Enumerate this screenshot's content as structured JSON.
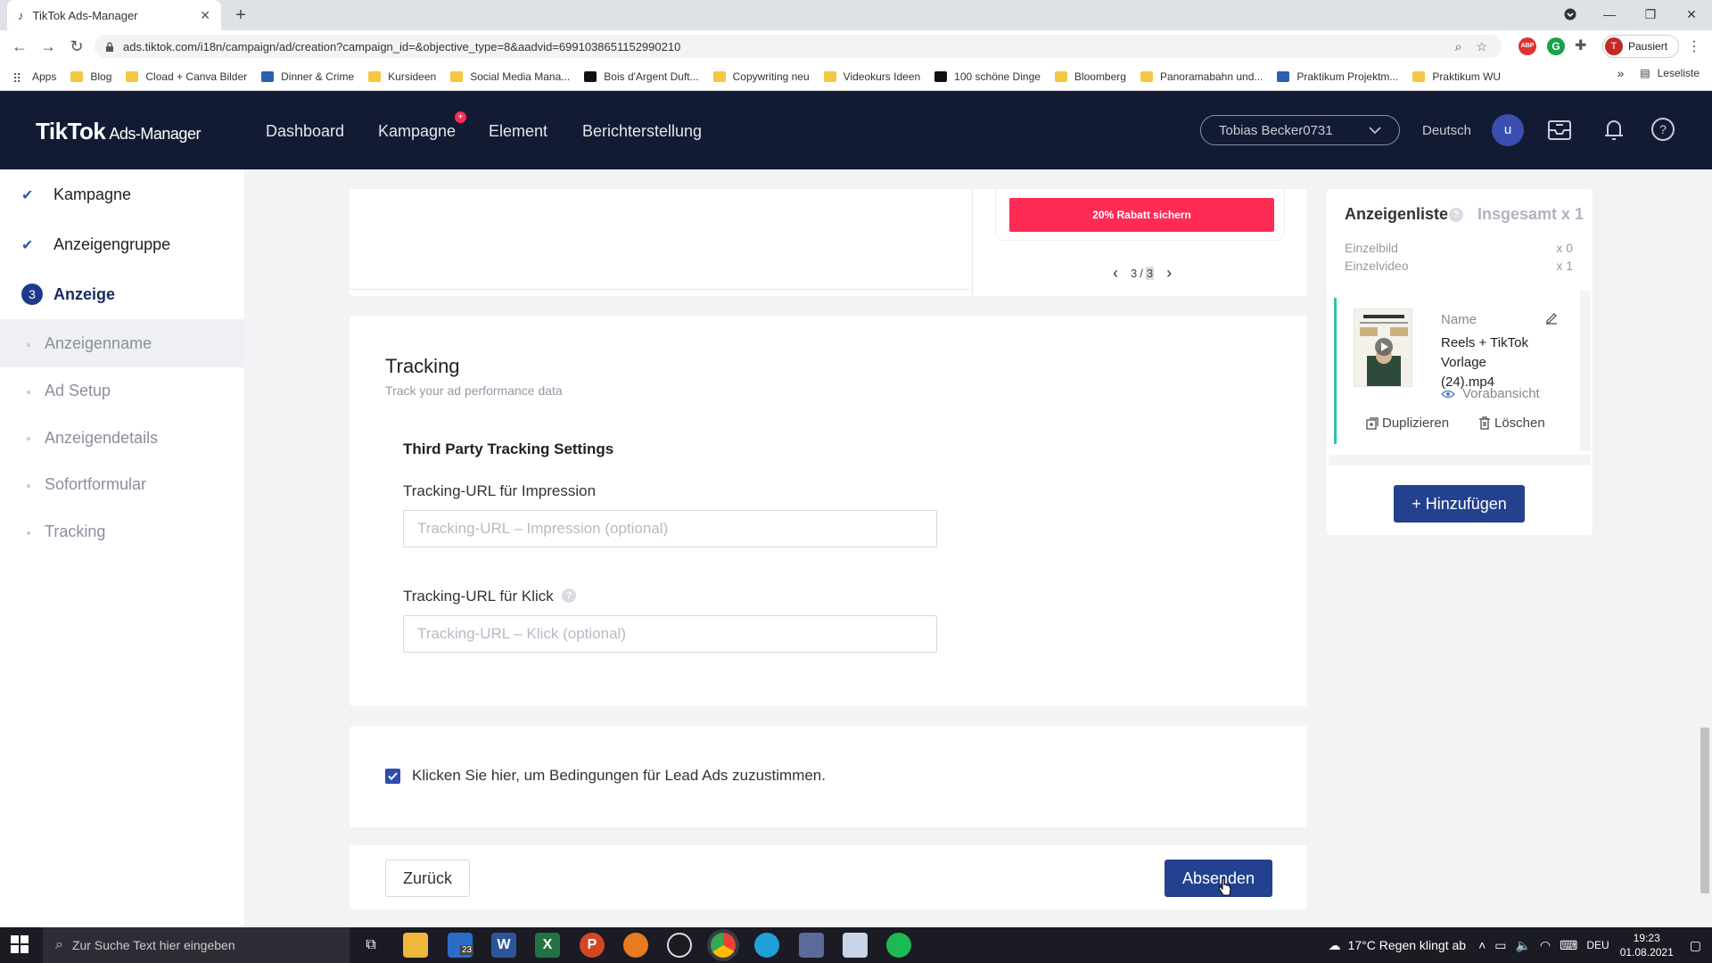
{
  "browser": {
    "tab_title": "TikTok Ads-Manager",
    "url": "ads.tiktok.com/i18n/campaign/ad/creation?campaign_id=&objective_type=8&aadvid=6991038651152990210",
    "profile_label": "Pausiert",
    "profile_initial": "T",
    "bookmarks": [
      {
        "label": "Apps",
        "icon": "apps-grid-icon"
      },
      {
        "label": "Blog",
        "icon": "folder-icon"
      },
      {
        "label": "Cload + Canva Bilder",
        "icon": "folder-icon"
      },
      {
        "label": "Dinner & Crime",
        "icon": "jd-icon"
      },
      {
        "label": "Kursideen",
        "icon": "folder-icon"
      },
      {
        "label": "Social Media Mana...",
        "icon": "folder-icon"
      },
      {
        "label": "Bois d'Argent Duft...",
        "icon": "bois-icon"
      },
      {
        "label": "Copywriting neu",
        "icon": "folder-icon"
      },
      {
        "label": "Videokurs Ideen",
        "icon": "folder-icon"
      },
      {
        "label": "100 schöne Dinge",
        "icon": "b-icon"
      },
      {
        "label": "Bloomberg",
        "icon": "folder-icon"
      },
      {
        "label": "Panoramabahn und...",
        "icon": "folder-icon"
      },
      {
        "label": "Praktikum Projektm...",
        "icon": "j-icon"
      },
      {
        "label": "Praktikum WU",
        "icon": "folder-icon"
      }
    ],
    "more": "»",
    "reading_list": "Leseliste"
  },
  "header": {
    "logo": "TikTok",
    "logo_sub": "Ads-Manager",
    "nav": [
      "Dashboard",
      "Kampagne",
      "Element",
      "Berichterstellung"
    ],
    "account": "Tobias Becker0731",
    "language": "Deutsch",
    "avatar_initial": "u"
  },
  "sidebar": {
    "steps": [
      {
        "label": "Kampagne",
        "state": "done"
      },
      {
        "label": "Anzeigengruppe",
        "state": "done"
      },
      {
        "label": "Anzeige",
        "number": "3",
        "state": "active"
      }
    ],
    "substeps": [
      "Anzeigenname",
      "Ad Setup",
      "Anzeigendetails",
      "Sofortformular",
      "Tracking"
    ],
    "active_substep": "Anzeigenname"
  },
  "preview": {
    "cta": "20% Rabatt sichern",
    "page_current": "3",
    "page_total": "3",
    "page_sep": "/"
  },
  "tracking": {
    "title": "Tracking",
    "subtitle": "Track your ad performance data",
    "section_title": "Third Party Tracking Settings",
    "impression_label": "Tracking-URL für Impression",
    "impression_placeholder": "Tracking-URL – Impression (optional)",
    "impression_value": "",
    "click_label": "Tracking-URL für Klick",
    "click_placeholder": "Tracking-URL – Klick (optional)",
    "click_value": ""
  },
  "terms": {
    "label": "Klicken Sie hier, um Bedingungen für Lead Ads zuzustimmen.",
    "checked": true
  },
  "actions": {
    "back": "Zurück",
    "submit": "Absenden"
  },
  "ad_list": {
    "title": "Anzeigenliste",
    "total": "Insgesamt x 1",
    "rows": [
      {
        "label": "Einzelbild",
        "count": "x 0"
      },
      {
        "label": "Einzelvideo",
        "count": "x 1"
      }
    ],
    "item": {
      "name_label": "Name",
      "name": "Reels + TikTok Vorlage (24).mp4",
      "preview": "Vorabansicht",
      "duplicate": "Duplizieren",
      "delete": "Löschen"
    },
    "add_button": "+ Hinzufügen"
  },
  "taskbar": {
    "search_placeholder": "Zur Suche Text hier eingeben",
    "mail_badge": "23",
    "weather": "17°C  Regen klingt ab",
    "lang": "DEU",
    "time": "19:23",
    "date": "01.08.2021"
  },
  "colors": {
    "header_bg": "#121b33",
    "primary": "#23418f",
    "cta": "#fe2c55",
    "accent_green": "#2bc3a7"
  }
}
